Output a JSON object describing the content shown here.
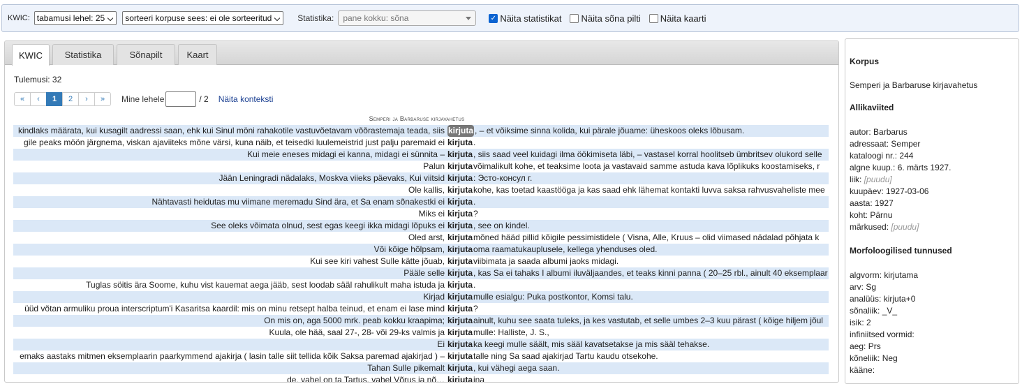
{
  "toolbar": {
    "kwic_label": "KWIC:",
    "hits_per_page": "tabamusi lehel: 25",
    "sort": "sorteeri korpuse sees: ei ole sorteeritud",
    "stat_label": "Statistika:",
    "stat_value": "pane kokku: sõna",
    "show_stats": "Näita statistikat",
    "show_wordpic": "Näita sõna pilti",
    "show_map": "Näita kaarti"
  },
  "tabs": [
    "KWIC",
    "Statistika",
    "Sõnapilt",
    "Kaart"
  ],
  "results": "Tulemusi: 32",
  "pager": {
    "buttons": [
      "«",
      "‹",
      "1",
      "2",
      "›",
      "»"
    ],
    "goto_label": "Mine lehele",
    "total": "/ 2",
    "show_context": "Näita konteksti"
  },
  "corpus_heading": "Semperi ja Barbaruse kirjavahetus",
  "kwic_rows": [
    {
      "left": "kindlaks määrata, kui kusagilt aadressi saan, ehk kui Sinul möni rahakotile vastuvõetavam võõrastemaja teada, siis",
      "match": "kirjuta",
      "right": ", – et võiksime sinna kolida, kui pärale jõuame: üheskoos oleks lõbusam."
    },
    {
      "left": "gile peaks möön järgnema, viskan ajaviiteks mõne värsi, kuna näib, et teisedki luulemeistrid just palju paremaid ei",
      "match": "kirjuta",
      "right": "."
    },
    {
      "left": "Kui meie eneses midagi ei kanna, midagi ei sünnita –",
      "match": "kirjuta",
      "right": ", siis saad veel kuidagi ilma öökimiseta läbi, – vastasel korral hoolitseb ümbritsev olukord selle"
    },
    {
      "left": "Palun",
      "match": "kirjuta",
      "right": "võimalikult kohe, et teaksime loota ja vastavaid samme astuda kava lõplikuks koostamiseks, r"
    },
    {
      "left": "Jään Leningradi nädalaks, Moskva viieks päevaks, Kui viitsid",
      "match": "kirjuta",
      "right": ": Эсто-консул г."
    },
    {
      "left": "Ole kallis,",
      "match": "kirjuta",
      "right": "kohe, kas toetad kaastööga ja kas saad ehk lähemat kontakti luvva saksa rahvusvaheliste mee"
    },
    {
      "left": "Nähtavasti heidutas mu viimane meremadu Sind ära, et Sa enam sõnakestki ei",
      "match": "kirjuta",
      "right": "."
    },
    {
      "left": "Miks ei",
      "match": "kirjuta",
      "right": "?"
    },
    {
      "left": "See oleks võimata olnud, sest egas keegi ikka midagi lõpuks ei",
      "match": "kirjuta",
      "right": ", see on kindel."
    },
    {
      "left": "Oled arst,",
      "match": "kirjuta",
      "right": "mõned hääd pillid kõigile pessimistidele ( Visna, Alle, Kruus – olid viimased nädalad põhjata k"
    },
    {
      "left": "Või kõige hõlpsam,",
      "match": "kirjuta",
      "right": "oma raamatukauplusele, kellega yhenduses oled."
    },
    {
      "left": "Kui see kiri vahest Sulle kätte jõuab,",
      "match": "kirjuta",
      "right": "viibimata ja saada albumi jaoks midagi."
    },
    {
      "left": "Pääle selle",
      "match": "kirjuta",
      "right": ", kas Sa ei tahaks I albumi iluväljaandes, et teaks kinni panna ( 20–25 rbl., ainult 40 eksemplaar"
    },
    {
      "left": "Tuglas söitis ära Soome, kuhu vist kauemat aega jääb, sest loodab sääl rahulikult maha istuda ja",
      "match": "kirjuta",
      "right": "."
    },
    {
      "left": "Kirjad",
      "match": "kirjuta",
      "right": "mulle esialgu: Puka postkontor, Komsi talu."
    },
    {
      "left": "üüd võtan armuliku proua interscriptum'i Kasaritsa kaardil: mis on minu retsept halba teinud, et enam ei lase mind",
      "match": "kirjuta",
      "right": "?"
    },
    {
      "left": "On mis on, aga 5000 mrk. peab kokku kraapima;",
      "match": "kirjuta",
      "right": "ainult, kuhu see saata tuleks, ja kes vastutab, et selle umbes 2–3 kuu pärast ( kõige hiljem jõul"
    },
    {
      "left": "Kuula, ole hää, saal 27-, 28- või 29-ks valmis ja",
      "match": "kirjuta",
      "right": "mulle: Halliste, J. S.,"
    },
    {
      "left": "Ei",
      "match": "kirjuta",
      "right": "ka keegi mulle säält, mis sääl kavatsetakse ja mis sääl tehakse."
    },
    {
      "left": "emaks aastaks mitmen eksemplaarin paarkymmend ajakirja ( lasin talle siit tellida kõik Saksa paremad ajakirjad ) –",
      "match": "kirjuta",
      "right": "talle ning Sa saad ajakirjad Tartu kaudu otsekohe."
    },
    {
      "left": "Tahan Sulle pikemalt",
      "match": "kirjuta",
      "right": ", kui vähegi aega saan."
    },
    {
      "left": "de, vahel on ta Tartus, vahel Võrus ja nõ…",
      "match": "kirjuta",
      "right": "ina"
    }
  ],
  "side": {
    "corpus_title": "Korpus",
    "corpus_name": "Semperi ja Barbaruse kirjavahetus",
    "source_title": "Allikaviited",
    "source_lines": [
      {
        "k": "autor:",
        "v": "Barbarus"
      },
      {
        "k": "adressaat:",
        "v": "Semper"
      },
      {
        "k": "kataloogi nr.:",
        "v": "244"
      },
      {
        "k": "algne kuup.:",
        "v": "6. märts 1927."
      },
      {
        "k": "liik:",
        "v": "[puudu]",
        "muted": true
      },
      {
        "k": "kuupäev:",
        "v": "1927-03-06"
      },
      {
        "k": "aasta:",
        "v": "1927"
      },
      {
        "k": "koht:",
        "v": "Pärnu"
      },
      {
        "k": "märkused:",
        "v": "[puudu]",
        "muted": true
      }
    ],
    "morph_title": "Morfoloogilised tunnused",
    "morph_lines": [
      {
        "k": "algvorm:",
        "v": "kirjutama"
      },
      {
        "k": "arv:",
        "v": "Sg"
      },
      {
        "k": "analüüs:",
        "v": "kirjuta+0"
      },
      {
        "k": "sõnaliik:",
        "v": "_V_"
      },
      {
        "k": "isik:",
        "v": "2"
      },
      {
        "k": "infiniitsed vormid:",
        "v": ""
      },
      {
        "k": "aeg:",
        "v": "Prs"
      },
      {
        "k": "kõneliik:",
        "v": "Neg"
      },
      {
        "k": "kääne:",
        "v": ""
      }
    ]
  }
}
